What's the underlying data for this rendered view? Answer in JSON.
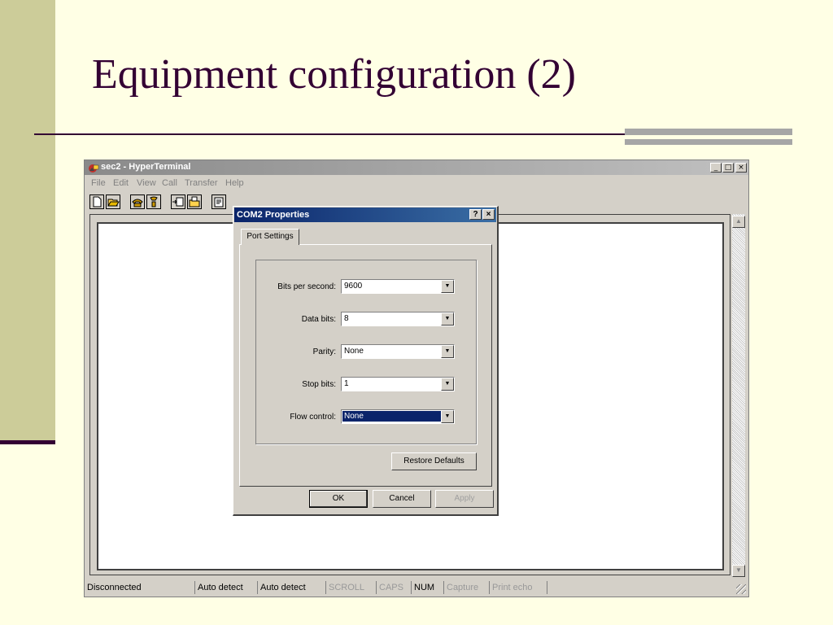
{
  "slide": {
    "title": "Equipment configuration (2)"
  },
  "window": {
    "title": "sec2 - HyperTerminal",
    "controls": {
      "minimize": "_",
      "maximize": "□",
      "close": "×"
    },
    "menu": [
      "File",
      "Edit",
      "View",
      "Call",
      "Transfer",
      "Help"
    ],
    "toolbar_icons": [
      "new-icon",
      "open-icon",
      "call-icon",
      "disconnect-icon",
      "send-icon",
      "receive-icon",
      "properties-icon"
    ]
  },
  "statusbar": {
    "items": [
      {
        "label": "Disconnected",
        "enabled": true
      },
      {
        "label": "Auto detect",
        "enabled": true
      },
      {
        "label": "Auto detect",
        "enabled": true
      },
      {
        "label": "SCROLL",
        "enabled": false
      },
      {
        "label": "CAPS",
        "enabled": false
      },
      {
        "label": "NUM",
        "enabled": true
      },
      {
        "label": "Capture",
        "enabled": false
      },
      {
        "label": "Print echo",
        "enabled": false
      }
    ]
  },
  "dialog": {
    "title": "COM2 Properties",
    "help": "?",
    "close": "×",
    "tab": "Port Settings",
    "fields": {
      "bits_per_second": {
        "label": "Bits per second:",
        "value": "9600"
      },
      "data_bits": {
        "label": "Data bits:",
        "value": "8"
      },
      "parity": {
        "label": "Parity:",
        "value": "None"
      },
      "stop_bits": {
        "label": "Stop bits:",
        "value": "1"
      },
      "flow_control": {
        "label": "Flow control:",
        "value": "None"
      }
    },
    "restore_defaults": "Restore Defaults",
    "ok": "OK",
    "cancel": "Cancel",
    "apply": "Apply"
  },
  "colors": {
    "slide_background": "#ffffe5",
    "slide_accent": "#cccc99",
    "title_color": "#330033",
    "dialog_title": "#0a246a"
  }
}
